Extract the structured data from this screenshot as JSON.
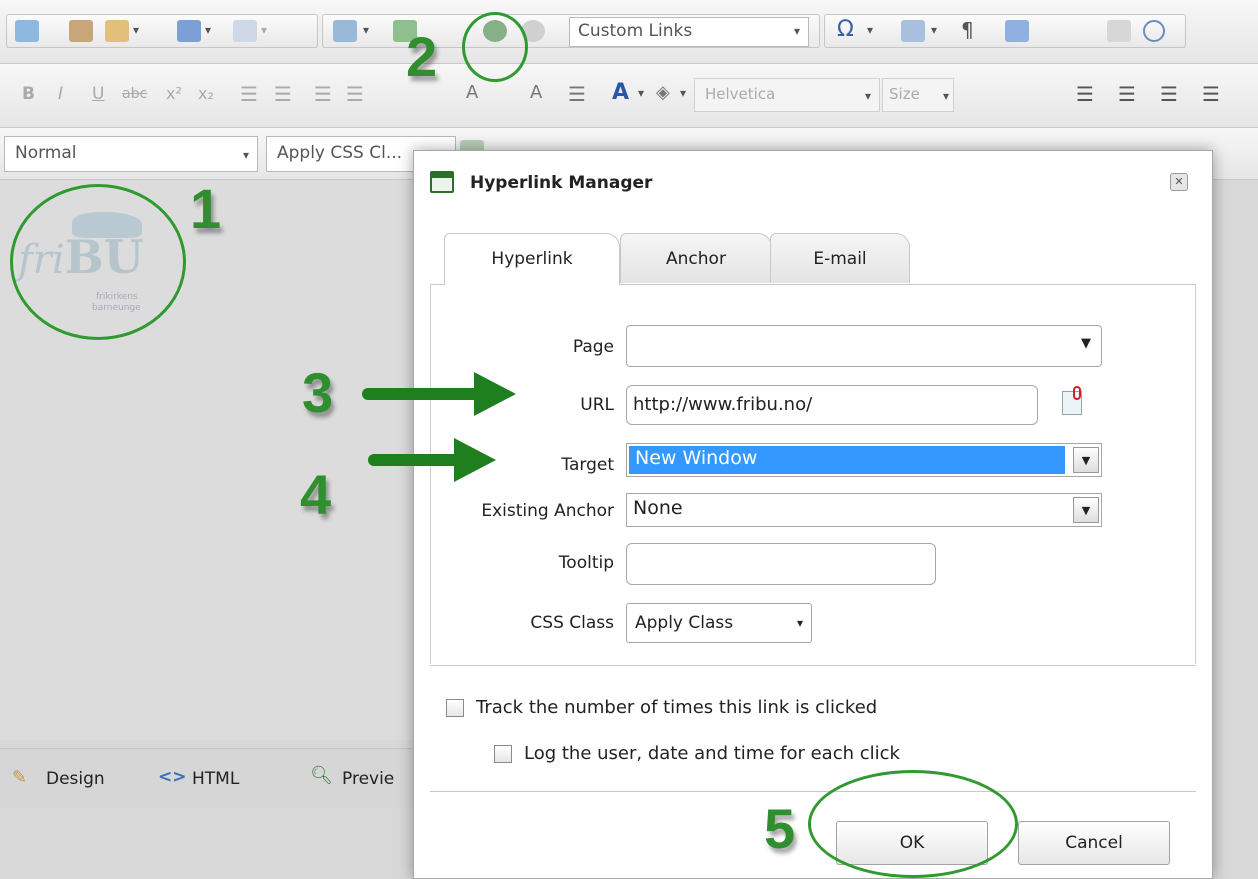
{
  "toolbar": {
    "custom_links": "Custom Links",
    "font_name": "Helvetica",
    "font_size": "Size",
    "paragraph_style": "Normal",
    "css_class": "Apply CSS Cl..."
  },
  "editor": {
    "logo_main": "friBU",
    "logo_sub1": "frikirkens",
    "logo_sub2": "barneunge",
    "tabs": {
      "design": "Design",
      "html": "HTML",
      "preview": "Previe"
    }
  },
  "dialog": {
    "title": "Hyperlink Manager",
    "tabs": {
      "hyperlink": "Hyperlink",
      "anchor": "Anchor",
      "email": "E-mail"
    },
    "fields": {
      "page_label": "Page",
      "page_value": "",
      "url_label": "URL",
      "url_value": "http://www.fribu.no/",
      "target_label": "Target",
      "target_value": "New Window",
      "anchor_label": "Existing Anchor",
      "anchor_value": "None",
      "tooltip_label": "Tooltip",
      "tooltip_value": "",
      "css_label": "CSS Class",
      "css_value": "Apply Class"
    },
    "track_label": "Track the number of times this link is clicked",
    "log_label": "Log the user, date and time for each click",
    "ok_label": "OK",
    "cancel_label": "Cancel"
  },
  "annotations": {
    "n1": "1",
    "n2": "2",
    "n3": "3",
    "n4": "4",
    "n5": "5"
  },
  "colors": {
    "annotation": "#2f8f2f",
    "selection": "#3399ff",
    "dialog_bg": "#ffffff"
  }
}
